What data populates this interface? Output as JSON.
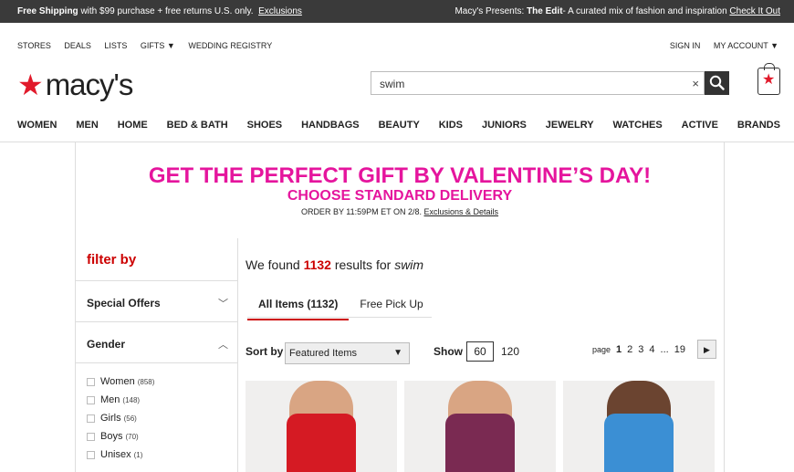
{
  "topbar": {
    "left_bold": "Free Shipping",
    "left_text": " with $99 purchase + free returns U.S. only.",
    "left_link": "Exclusions",
    "right_text": "Macy's Presents: ",
    "right_bold": "The Edit",
    "right_text2": "- A curated mix of fashion and inspiration ",
    "right_link": "Check It Out"
  },
  "utility": {
    "stores": "STORES",
    "deals": "DEALS",
    "lists": "LISTS",
    "gifts": "GIFTS ▼",
    "wedding": "WEDDING REGISTRY",
    "signin": "SIGN IN",
    "account": "MY ACCOUNT ▼"
  },
  "logo": {
    "text": "macy's"
  },
  "search": {
    "value": "swim",
    "clear": "×"
  },
  "nav": [
    "WOMEN",
    "MEN",
    "HOME",
    "BED & BATH",
    "SHOES",
    "HANDBAGS",
    "BEAUTY",
    "KIDS",
    "JUNIORS",
    "JEWELRY",
    "WATCHES",
    "ACTIVE",
    "BRANDS"
  ],
  "promo": {
    "line1": "GET THE PERFECT GIFT BY VALENTINE’S DAY!",
    "line2": "CHOOSE STANDARD DELIVERY",
    "line3": "ORDER BY 11:59PM ET ON 2/8.",
    "link": "Exclusions & Details"
  },
  "sidebar": {
    "title": "filter by",
    "special_offers": "Special Offers",
    "gender": "Gender",
    "gender_items": [
      {
        "label": "Women",
        "count": "(858)"
      },
      {
        "label": "Men",
        "count": "(148)"
      },
      {
        "label": "Girls",
        "count": "(56)"
      },
      {
        "label": "Boys",
        "count": "(70)"
      },
      {
        "label": "Unisex",
        "count": "(1)"
      }
    ]
  },
  "results": {
    "prefix": "We found ",
    "count": "1132",
    "middle": " results for ",
    "term": "swim"
  },
  "tabs": {
    "all": "All Items (1132)",
    "pickup": "Free Pick Up"
  },
  "sort": {
    "label": "Sort by",
    "selected": "Featured Items"
  },
  "show": {
    "label": "Show",
    "selected": "60",
    "other": "120"
  },
  "pager": {
    "label": "page",
    "pages": [
      "1",
      "2",
      "3",
      "4",
      "...",
      "19"
    ],
    "next": "▶"
  }
}
